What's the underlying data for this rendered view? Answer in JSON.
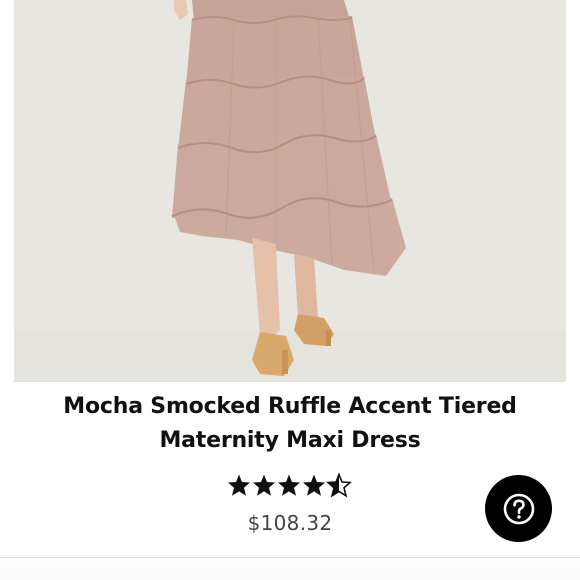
{
  "product": {
    "image_description_icon": "dress-photo",
    "title": "Mocha Smocked Ruffle Accent Tiered Maternity Maxi Dress",
    "rating_stars": 4.5,
    "rating_max": 5,
    "price": "$108.32"
  },
  "help": {
    "icon": "question-circle-icon"
  },
  "colors": {
    "title": "#111111",
    "price": "#444444",
    "help_button": "#000000",
    "star": "#111111"
  }
}
